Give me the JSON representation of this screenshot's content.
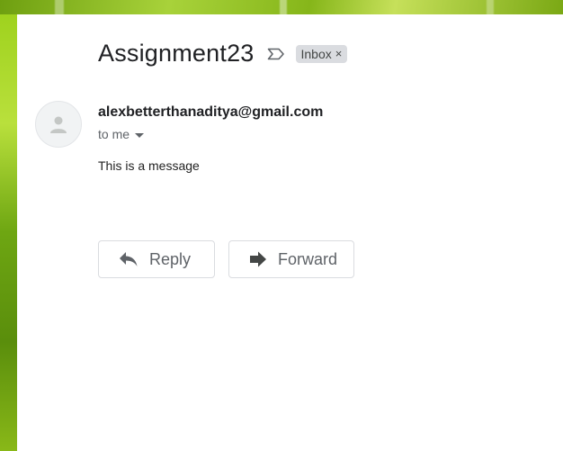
{
  "message": {
    "subject": "Assignment23",
    "label": "Inbox",
    "label_remove": "×",
    "sender": "alexbetterthanaditya@gmail.com",
    "recipient": "to me",
    "body": "This is a message"
  },
  "actions": {
    "reply_label": "Reply",
    "forward_label": "Forward"
  },
  "colors": {
    "chip_bg": "#dadce0",
    "text_primary": "#202124",
    "text_secondary": "#5f6368"
  }
}
